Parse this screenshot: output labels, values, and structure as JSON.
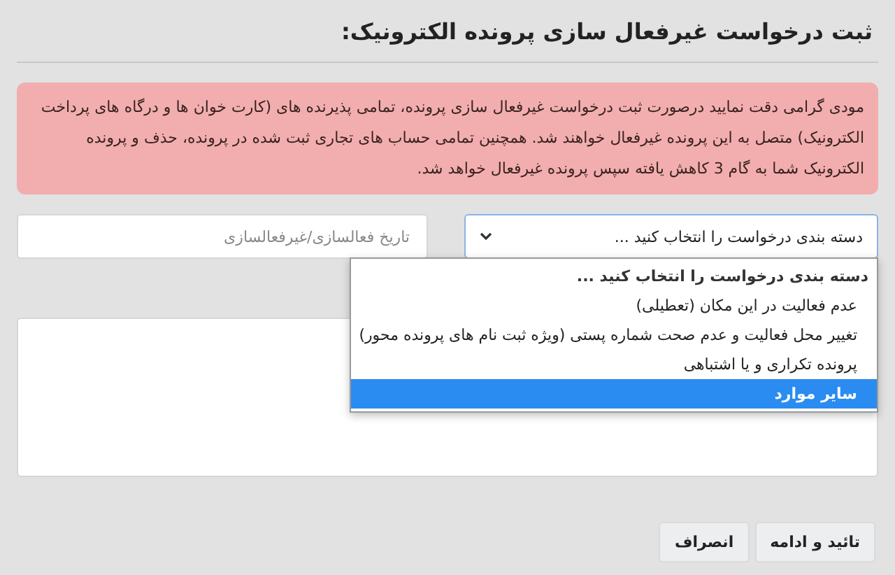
{
  "title": "ثبت درخواست غیرفعال سازی پرونده الکترونیک:",
  "alert": "مودی گرامی دقت نمایید درصورت ثبت درخواست غیرفعال سازی پرونده، تمامی پذیرنده های (کارت خوان ها و درگاه های پرداخت الکترونیک) متصل به این پرونده غیرفعال خواهند شد. همچنین تمامی حساب های تجاری ثبت شده در پرونده، حذف و پرونده الکترونیک شما به گام 3 کاهش یافته سپس پرونده غیرفعال خواهد شد.",
  "category_select": {
    "value": "دسته بندی درخواست را انتخاب کنید ...",
    "expanded": true,
    "options": [
      {
        "label": "دسته بندی درخواست را انتخاب کنید ...",
        "selected": true,
        "highlighted": false
      },
      {
        "label": "عدم فعالیت در این مکان (تعطیلی)",
        "selected": false,
        "highlighted": false
      },
      {
        "label": "تغییر محل فعالیت و عدم صحت شماره پستی (ویژه ثبت نام های پرونده محور)",
        "selected": false,
        "highlighted": false
      },
      {
        "label": "پرونده تکراری و یا اشتباهی",
        "selected": false,
        "highlighted": false
      },
      {
        "label": "سایر موارد",
        "selected": false,
        "highlighted": true
      }
    ]
  },
  "date_field": {
    "placeholder": "تاریخ فعالسازی/غیرفعالسازی"
  },
  "buttons": [
    "تائید و ادامه",
    "انصراف"
  ]
}
